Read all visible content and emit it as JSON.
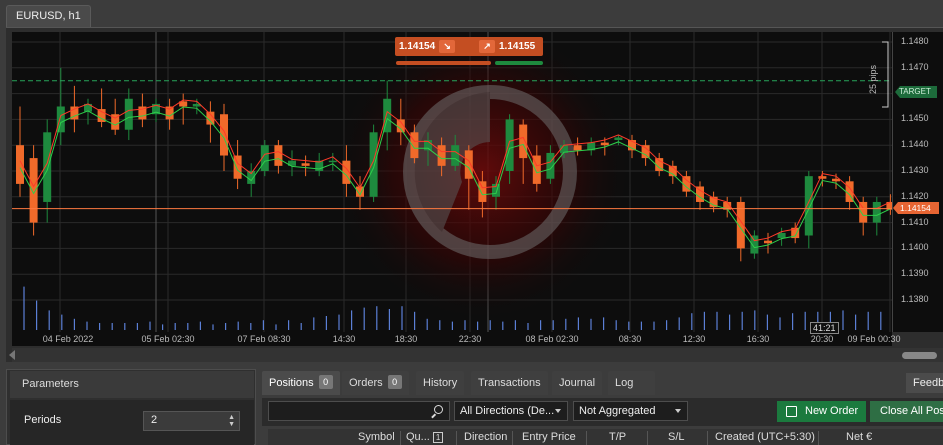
{
  "chart": {
    "tab_title": "EURUSD, h1",
    "bid": "1.14154",
    "ask": "1.14155",
    "sell_icon": "arrow-down-right-icon",
    "buy_icon": "arrow-up-right-icon",
    "target_label": "TARGET",
    "pips_label": "25 pips",
    "current_price": "1.14154",
    "countdown": "41:21",
    "price_ticks": [
      "1.1480",
      "1.1470",
      "1.1460",
      "1.1450",
      "1.1440",
      "1.1430",
      "1.1420",
      "1.1410",
      "1.1400",
      "1.1390",
      "1.1380"
    ],
    "time_ticks": [
      "04 Feb 2022",
      "05 Feb 02:30",
      "07 Feb 08:30",
      "14:30",
      "18:30",
      "22:30",
      "08 Feb 02:30",
      "08:30",
      "12:30",
      "16:30",
      "20:30",
      "09 Feb 00:30"
    ],
    "colors": {
      "bull": "#1e8a3e",
      "bear": "#f06a2a",
      "target": "#27a35a",
      "current": "#ff7a40"
    }
  },
  "params": {
    "title": "Parameters",
    "periods_label": "Periods",
    "periods_value": "2"
  },
  "tabs": [
    {
      "label": "Positions",
      "count": "0"
    },
    {
      "label": "Orders",
      "count": "0"
    },
    {
      "label": "History"
    },
    {
      "label": "Transactions"
    },
    {
      "label": "Journal"
    },
    {
      "label": "Log"
    }
  ],
  "feedback_label": "Feedb",
  "filters": {
    "directions": "All Directions (De...",
    "aggregation": "Not Aggregated"
  },
  "buttons": {
    "new_order": "New Order",
    "close_all": "Close All Pos"
  },
  "table_columns": {
    "symbol": "Symbol",
    "quantity": "Qu...",
    "sort": "1",
    "direction": "Direction",
    "entry": "Entry Price",
    "tp": "T/P",
    "sl": "S/L",
    "created": "Created (UTC+5:30)",
    "net": "Net €"
  }
}
